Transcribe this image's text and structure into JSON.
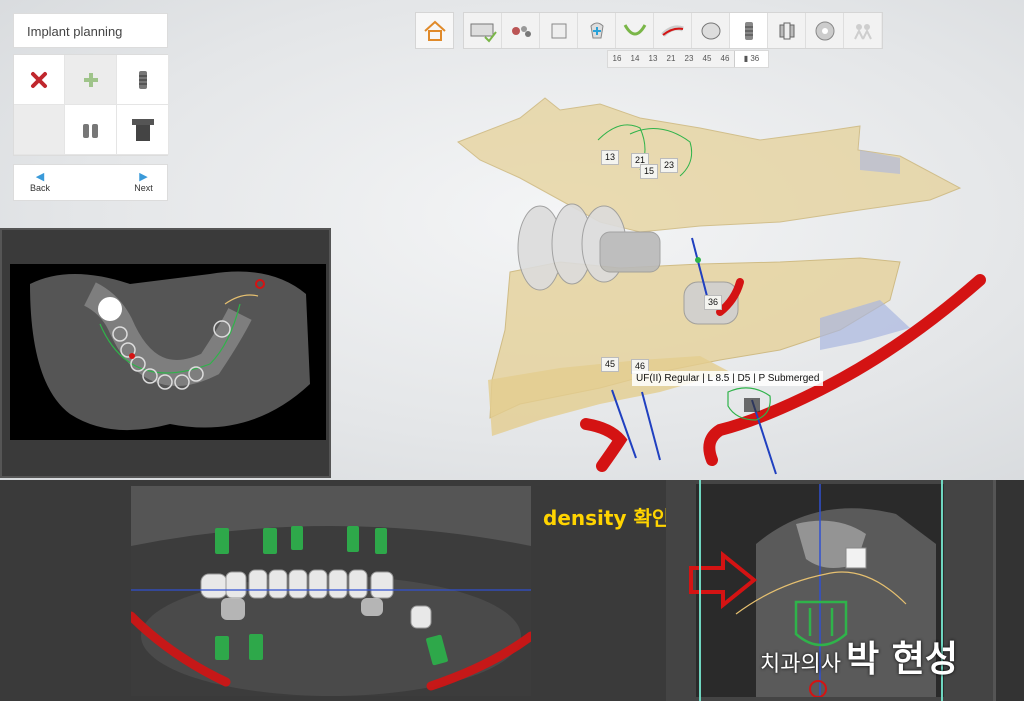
{
  "panel": {
    "title": "Implant planning",
    "tools": [
      {
        "icon": "delete-x-icon"
      },
      {
        "icon": "add-plus-icon"
      },
      {
        "icon": "implant-icon"
      },
      {
        "icon": "empty"
      },
      {
        "icon": "multi-implant-icon"
      },
      {
        "icon": "sleeve-icon"
      }
    ],
    "back_label": "Back",
    "next_label": "Next"
  },
  "workflow": {
    "steps": [
      "home-icon",
      "scan-data-icon",
      "bone-segmentation-icon",
      "alignment-icon",
      "tooth-setup-icon",
      "arch-icon",
      "nerve-canal-icon",
      "crown-icon",
      "implant-icon",
      "sleeve-icon",
      "guide-icon",
      "export-icon"
    ],
    "active_step": "implant-icon"
  },
  "tooth_tabs": [
    "16",
    "14",
    "13",
    "21",
    "23",
    "45",
    "46",
    "36"
  ],
  "active_tooth": "36",
  "tooth_labels": {
    "t13": "13",
    "t14": "14",
    "t21": "21",
    "t15": "15",
    "t23": "23",
    "t36": "36",
    "t45": "45",
    "t46": "46"
  },
  "implant_info": "UF(II) Regular | L 8.5 | D5 | P Submerged",
  "density_note": "density 확인",
  "watermark": {
    "title": "치과의사",
    "name": "박 현성"
  },
  "colors": {
    "bone_model": "#e6d29a",
    "nerve": "#d41313",
    "implant_guide": "#2fb34a",
    "annotation": "#ffd400"
  }
}
